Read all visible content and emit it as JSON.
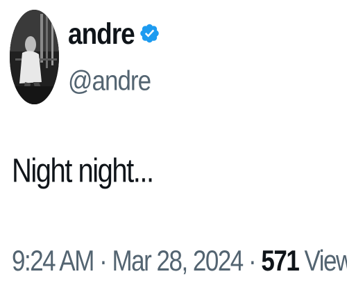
{
  "author": {
    "display_name": "andre",
    "handle": "@andre",
    "verified": true,
    "avatar": "profile-photo"
  },
  "tweet": {
    "text": "Night night..."
  },
  "meta": {
    "time": "9:24 AM",
    "separator1": " · ",
    "date": "Mar 28, 2024",
    "separator2": " · ",
    "views_count": "571",
    "views_label": " Views"
  },
  "colors": {
    "text_primary": "#0f1419",
    "text_secondary": "#536471",
    "verified_blue": "#1d9bf0"
  }
}
